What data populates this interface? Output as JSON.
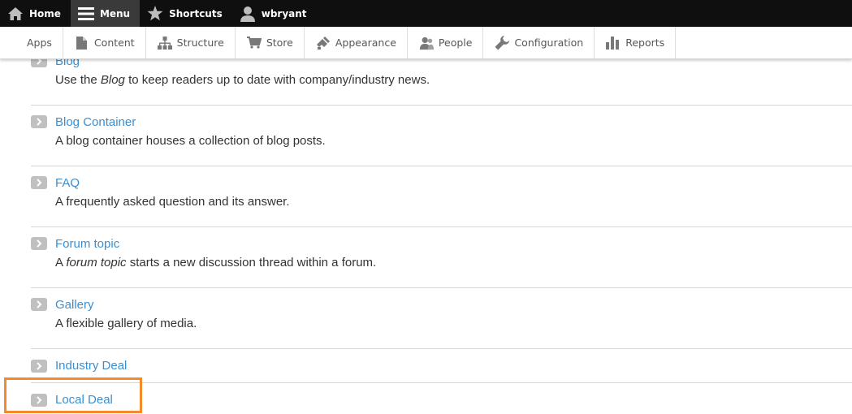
{
  "toolbar": {
    "home": "Home",
    "menu": "Menu",
    "shortcuts": "Shortcuts",
    "user": "wbryant"
  },
  "tray": {
    "items": [
      "Apps",
      "Content",
      "Structure",
      "Store",
      "Appearance",
      "People",
      "Configuration",
      "Reports"
    ]
  },
  "content_types": [
    {
      "title": "Blog",
      "desc_pre": "Use the ",
      "desc_em": "Blog",
      "desc_post": " to keep readers up to date with company/industry news."
    },
    {
      "title": "Blog Container",
      "desc_pre": "A blog container houses a collection of blog posts.",
      "desc_em": "",
      "desc_post": ""
    },
    {
      "title": "FAQ",
      "desc_pre": "A frequently asked question and its answer.",
      "desc_em": "",
      "desc_post": ""
    },
    {
      "title": "Forum topic",
      "desc_pre": "A ",
      "desc_em": "forum topic",
      "desc_post": " starts a new discussion thread within a forum."
    },
    {
      "title": "Gallery",
      "desc_pre": "A flexible gallery of media.",
      "desc_em": "",
      "desc_post": ""
    },
    {
      "title": "Industry Deal"
    },
    {
      "title": "Local Deal"
    }
  ],
  "colors": {
    "link": "#3b8fd1",
    "highlight": "#f58a2a",
    "toolbar_bg": "#0f0f0f"
  }
}
